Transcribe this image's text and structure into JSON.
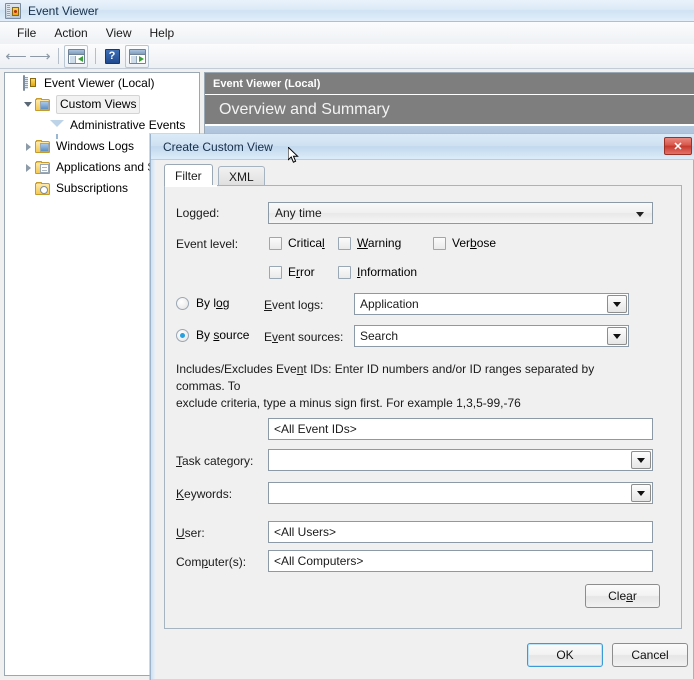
{
  "window": {
    "title": "Event Viewer",
    "icon": "event-viewer-icon",
    "menus": [
      "File",
      "Action",
      "View",
      "Help"
    ],
    "toolbar": [
      {
        "name": "back-icon",
        "glyph": "←"
      },
      {
        "name": "forward-icon",
        "glyph": "→"
      },
      {
        "name": "show-hide-console-tree-icon"
      },
      {
        "name": "help-icon",
        "glyph": "?"
      },
      {
        "name": "show-hide-action-pane-icon"
      }
    ]
  },
  "tree": {
    "items": [
      {
        "label": "Event Viewer (Local)",
        "icon": "event-viewer-icon",
        "indent": 0,
        "expander": "none",
        "selected": false
      },
      {
        "label": "Custom Views",
        "icon": "folder-custom-views-icon",
        "indent": 1,
        "expander": "open",
        "selected": true
      },
      {
        "label": "Administrative Events",
        "icon": "funnel-icon",
        "indent": 2,
        "expander": "none",
        "selected": false
      },
      {
        "label": "Windows Logs",
        "icon": "folder-windows-logs-icon",
        "indent": 1,
        "expander": "closed",
        "selected": false
      },
      {
        "label": "Applications and Se",
        "icon": "folder-applications-icon",
        "indent": 1,
        "expander": "closed",
        "selected": false
      },
      {
        "label": "Subscriptions",
        "icon": "folder-subscriptions-icon",
        "indent": 1,
        "expander": "none",
        "selected": false
      }
    ]
  },
  "content": {
    "header": "Event Viewer (Local)",
    "overview_title": "Overview and Summary"
  },
  "dialog": {
    "title": "Create Custom View",
    "close_label": "✕",
    "tabs": [
      {
        "label": "Filter",
        "active": true
      },
      {
        "label": "XML",
        "active": false
      }
    ],
    "logged": {
      "label": "Logged:",
      "value": "Any time"
    },
    "event_level": {
      "label": "Event level:",
      "checkboxes": [
        {
          "label": "Critical",
          "accesskey_index": 7,
          "checked": false
        },
        {
          "label": "Warning",
          "accesskey_index": 0,
          "checked": false
        },
        {
          "label": "Verbose",
          "accesskey_index": 2,
          "checked": false
        },
        {
          "label": "Error",
          "accesskey_index": 1,
          "checked": false
        },
        {
          "label": "Information",
          "accesskey_index": 0,
          "checked": false
        }
      ]
    },
    "source_mode": {
      "by_log": {
        "label": "By log",
        "accesskey_index": 4,
        "selected": false
      },
      "by_source": {
        "label": "By source",
        "accesskey_index": 3,
        "selected": true
      }
    },
    "event_logs": {
      "label": "Event logs:",
      "accesskey_index": 0,
      "value": "Application"
    },
    "event_sources": {
      "label": "Event sources:",
      "accesskey_index": 1,
      "value": "Search"
    },
    "event_ids": {
      "description_line1": "Includes/Excludes Event IDs: Enter ID numbers and/or ID ranges separated by commas. To",
      "description_line2": "exclude criteria, type a minus sign first. For example 1,3,5-99,-76",
      "value": "<All Event IDs>"
    },
    "task_category": {
      "label": "Task category:",
      "value": ""
    },
    "keywords": {
      "label": "Keywords:",
      "value": ""
    },
    "user": {
      "label": "User:",
      "value": "<All Users>"
    },
    "computers": {
      "label": "Computer(s):",
      "value": "<All Computers>"
    },
    "clear_button": "Clear",
    "ok_button": "OK",
    "cancel_button": "Cancel"
  },
  "colors": {
    "accent": "#25a0e0",
    "dialog_bg": "#f0f0f0",
    "header_gray": "#7e7e7e",
    "close_red": "#c6392c"
  }
}
